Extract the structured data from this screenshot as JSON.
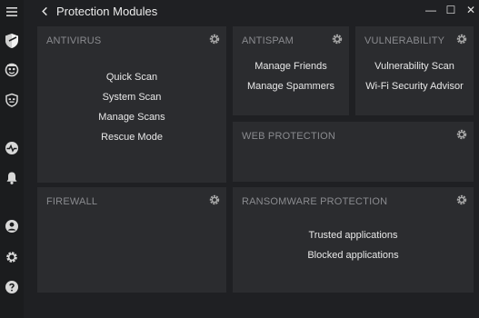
{
  "window": {
    "title": "Protection Modules",
    "controls": {
      "minimize": "—",
      "maximize": "☐",
      "close": "✕"
    }
  },
  "sidebar": {
    "items": [
      {
        "icon": "hamburger-menu-icon"
      },
      {
        "icon": "shield-icon",
        "active": true
      },
      {
        "icon": "privacy-face-icon"
      },
      {
        "icon": "face-shield-icon"
      },
      {
        "icon": "activity-pulse-icon"
      },
      {
        "icon": "bell-icon"
      },
      {
        "icon": "user-icon"
      },
      {
        "icon": "gear-icon"
      },
      {
        "icon": "help-icon"
      }
    ]
  },
  "modules": {
    "antivirus": {
      "title": "ANTIVIRUS",
      "links": [
        "Quick Scan",
        "System Scan",
        "Manage Scans",
        "Rescue Mode"
      ]
    },
    "antispam": {
      "title": "ANTISPAM",
      "links": [
        "Manage Friends",
        "Manage Spammers"
      ]
    },
    "vulnerability": {
      "title": "VULNERABILITY",
      "links": [
        "Vulnerability Scan",
        "Wi-Fi Security Advisor"
      ]
    },
    "web_protection": {
      "title": "WEB PROTECTION"
    },
    "firewall": {
      "title": "FIREWALL"
    },
    "ransomware": {
      "title": "RANSOMWARE PROTECTION",
      "links": [
        "Trusted applications",
        "Blocked applications"
      ]
    }
  },
  "colors": {
    "background": "#1f2023",
    "card": "#2b2c2f",
    "card_title": "#8a8b8f",
    "text": "#e8e8e8"
  }
}
